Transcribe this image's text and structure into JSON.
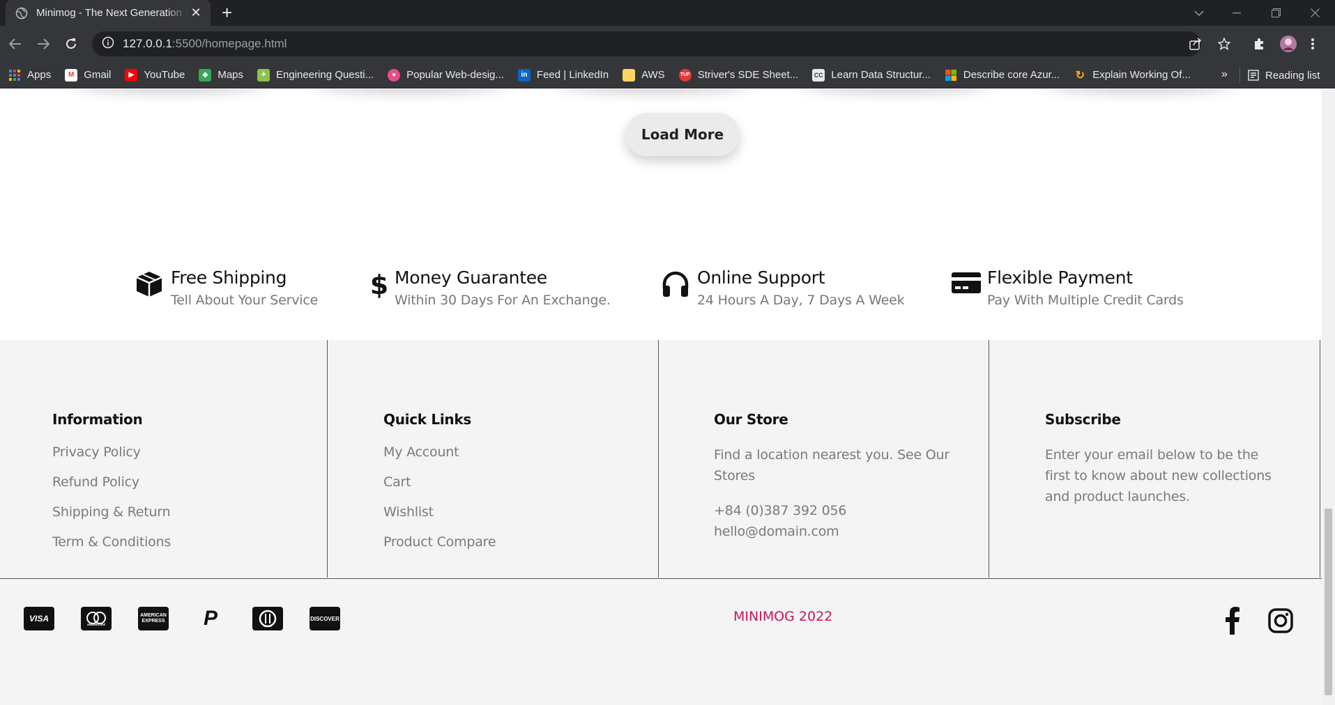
{
  "browser": {
    "tab_title": "Minimog - The Next Generation Shopify Theme",
    "url_host": "127.0.0.1",
    "url_path": ":5500/homepage.html",
    "bookmarks": [
      {
        "label": "Apps",
        "color": "#4285f4"
      },
      {
        "label": "Gmail",
        "color": "#ea4335"
      },
      {
        "label": "YouTube",
        "color": "#ff0000"
      },
      {
        "label": "Maps",
        "color": "#34a853"
      },
      {
        "label": "Engineering Questi...",
        "color": "#8bc34a"
      },
      {
        "label": "Popular Web-desig...",
        "color": "#ea4c89"
      },
      {
        "label": "Feed | LinkedIn",
        "color": "#0a66c2"
      },
      {
        "label": "AWS",
        "color": "#fdd663"
      },
      {
        "label": "Striver's SDE Sheet...",
        "color": "#e53935"
      },
      {
        "label": "Learn Data Structur...",
        "color": "#5f6368"
      },
      {
        "label": "Describe core Azur...",
        "color": "#00a4ef"
      },
      {
        "label": "Explain Working Of...",
        "color": "#f4b400"
      }
    ],
    "more_label": "»",
    "reading_list": "Reading list"
  },
  "page": {
    "load_more": "Load More",
    "features": [
      {
        "title": "Free Shipping",
        "subtitle": "Tell About Your Service",
        "icon": "box-icon"
      },
      {
        "title": "Money Guarantee",
        "subtitle": "Within 30 Days For An Exchange.",
        "icon": "dollar-icon"
      },
      {
        "title": "Online Support",
        "subtitle": "24 Hours A Day, 7 Days A Week",
        "icon": "headphones-icon"
      },
      {
        "title": "Flexible Payment",
        "subtitle": "Pay With Multiple Credit Cards",
        "icon": "credit-card-icon"
      }
    ],
    "footer": {
      "information": {
        "title": "Information",
        "links": [
          "Privacy Policy",
          "Refund Policy",
          "Shipping & Return",
          "Term & Conditions"
        ]
      },
      "quick_links": {
        "title": "Quick Links",
        "links": [
          "My Account",
          "Cart",
          "Wishlist",
          "Product Compare"
        ]
      },
      "our_store": {
        "title": "Our Store",
        "text_line1": "Find a location nearest you. See Our",
        "text_line2": "Stores",
        "phone": "+84 (0)387 392 056",
        "email": "hello@domain.com"
      },
      "subscribe": {
        "title": "Subscribe",
        "line1": "Enter your email below to be the",
        "line2": "first to know about new collections",
        "line3": "and product launches."
      }
    },
    "payments": [
      "VISA",
      "mastercard",
      "AMERICAN EXPRESS",
      "P",
      "Diners",
      "DISCOVER"
    ],
    "copyright": "MINIMOG 2022",
    "copyright_color": "#c2185b"
  }
}
